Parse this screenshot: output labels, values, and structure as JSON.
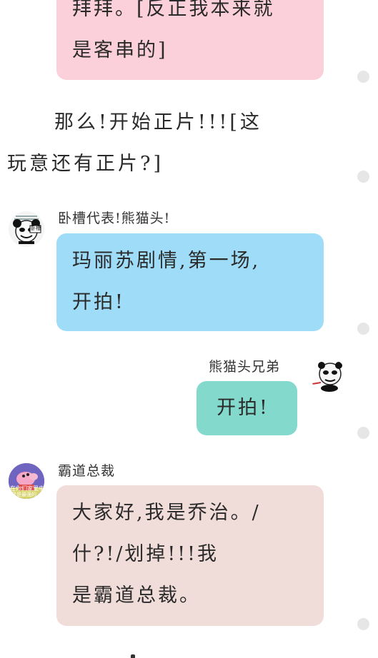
{
  "messages": {
    "m1": {
      "lines": [
        "拜拜。[反正我本来就",
        "是客串的]"
      ]
    },
    "narration": {
      "lines": [
        "那么!开始正片!!![这",
        "玩意还有正片?]"
      ]
    },
    "m2": {
      "sender": "卧槽代表!熊猫头!",
      "lines": [
        "玛丽苏剧情,第一场,",
        "开拍!"
      ]
    },
    "m3": {
      "sender": "熊猫头兄弟",
      "lines": [
        "开拍!"
      ]
    },
    "m4": {
      "sender": "霸道总裁",
      "lines": [
        "大家好,我是乔治。/",
        "什?!/划掉!!!我",
        "是霸道总裁。"
      ]
    }
  },
  "avatars": {
    "panda_meme_small_text": "卧槽",
    "peppa_caption_line1": "在你们家里中",
    "peppa_caption_line2": "我是最强的"
  },
  "colors": {
    "bubble_pink": "#fcd0db",
    "bubble_blue": "#9fdcf8",
    "bubble_teal": "#84d9cd",
    "bubble_beige": "#f0dcd8",
    "dot": "#e6e6e6"
  }
}
